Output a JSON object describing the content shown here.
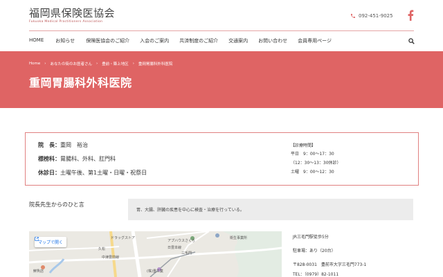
{
  "header": {
    "title": "福岡県保険医協会",
    "subtitle": "Fukuoka Medical Practitioners Association",
    "phone": "092-451-9025",
    "phone_icon": "phone-icon",
    "facebook_icon": "facebook-icon",
    "accent_color": "#df6464"
  },
  "nav": {
    "items": [
      {
        "label": "HOME"
      },
      {
        "label": "お知らせ"
      },
      {
        "label": "保険医協会のご紹介"
      },
      {
        "label": "入会のご案内"
      },
      {
        "label": "共済制度のご紹介"
      },
      {
        "label": "交通案内"
      },
      {
        "label": "お問い合わせ"
      },
      {
        "label": "会員専用ページ"
      }
    ],
    "search_icon": "search-icon"
  },
  "breadcrumb": {
    "items": [
      "Home",
      "あなたの街のお医者さん",
      "豊前・築上地区",
      "重岡胃腸科外科医院"
    ],
    "separator": "›"
  },
  "page": {
    "title": "重岡胃腸科外科医院"
  },
  "info": {
    "director_label": "院　長：",
    "director": "重岡　裕治",
    "dept_label": "標榜科：",
    "dept": "胃腸科、外科、肛門科",
    "closed_label": "休診日：",
    "closed": "土曜午後、第1土曜・日曜・祝祭日",
    "hours_title": "【診療時間】",
    "hours_weekday": "平日　9：00〜17：30",
    "hours_break": "（12：30〜13：30休診）",
    "hours_saturday": "土曜　9：00〜12：30"
  },
  "message": {
    "label": "院長先生からのひと言",
    "text": "胃、大腸、肝臓の疾患を中心に検査・治療を行っている。"
  },
  "map": {
    "open_label": "マップで開く",
    "labels": {
      "l1": "ドラッグストア",
      "l2": "アプハウスさくら",
      "l3": "衛生事業所",
      "l4": "久松",
      "l5": "中津豊前線",
      "l6": "三毛門",
      "l7": "日豊本線",
      "l8": "(株)重工業",
      "l9": "鮮魚店"
    }
  },
  "access": {
    "line1": "JR三毛門駅徒歩5分",
    "line2": "駐車場：あり（20台）",
    "line3": "〒828-0031　豊前市大字三毛門773-1",
    "line4": "TEL：（0979）82-1011"
  }
}
